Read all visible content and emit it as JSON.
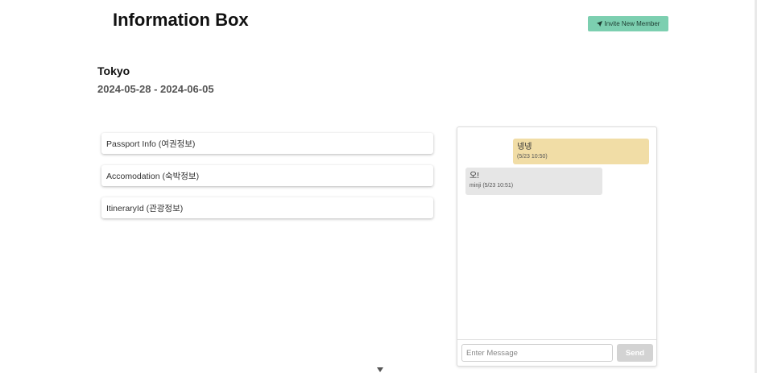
{
  "header": {
    "title": "Information Box",
    "invite_button_label": "Invite New Member",
    "invite_icon": "send-icon"
  },
  "trip": {
    "city": "Tokyo",
    "dates": "2024-05-28 - 2024-06-05"
  },
  "info_items": [
    {
      "label": "Passport Info (여권정보)"
    },
    {
      "label": "Accomodation (숙박정보)"
    },
    {
      "label": "ItineraryId (관광정보)"
    }
  ],
  "chat": {
    "messages": [
      {
        "text": "넹넹",
        "meta": "(5/23 10:50)",
        "mine": true
      },
      {
        "text": "오!",
        "meta": "minji (5/23 10:51)",
        "mine": false
      }
    ],
    "input_placeholder": "Enter Message",
    "send_label": "Send"
  },
  "colors": {
    "accent": "#7ccfb0",
    "my_message": "#f1dda6",
    "other_message": "#e6e6e6",
    "send_button_disabled": "#d3d3d3"
  }
}
